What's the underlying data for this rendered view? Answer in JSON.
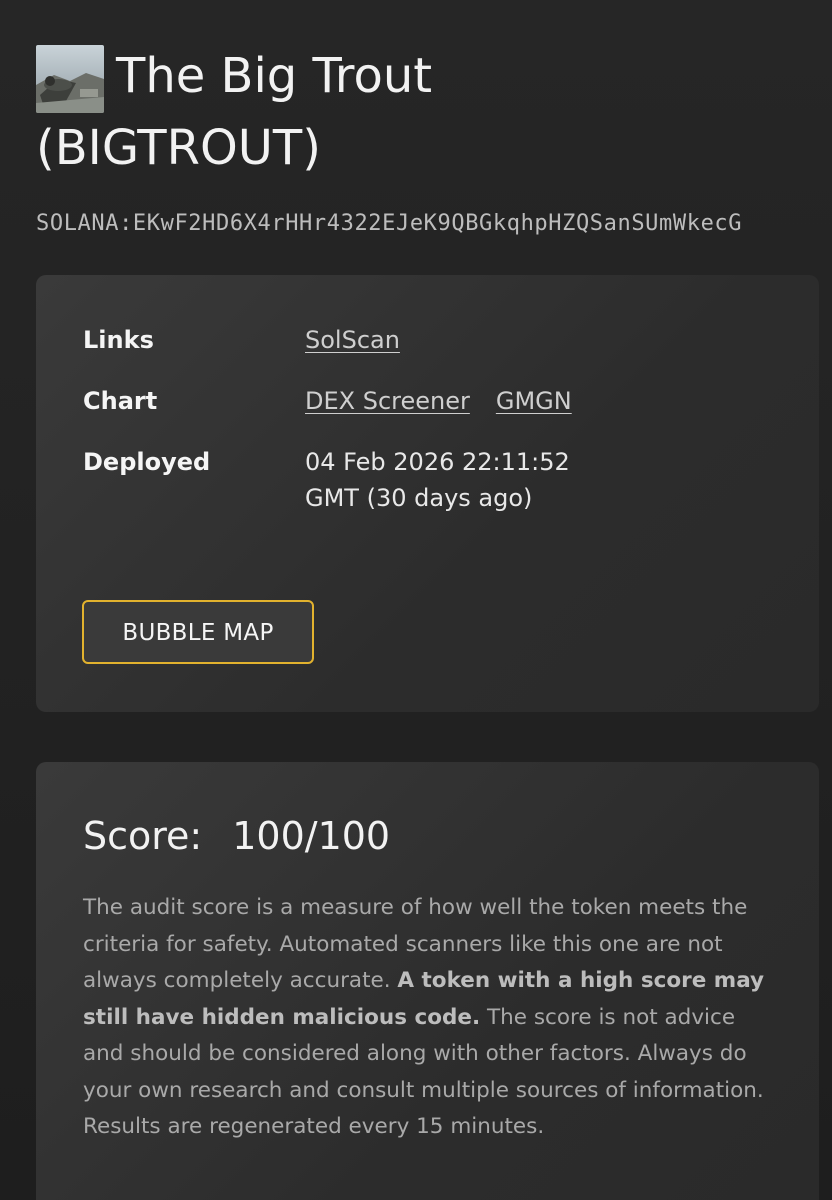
{
  "header": {
    "title_line1": "The Big Trout",
    "title_line2": "(BIGTROUT)",
    "address": "SOLANA:EKwF2HD6X4rHHr4322EJeK9QBGkqhpHZQSanSUmWkecG",
    "avatar_icon": "token-avatar-icon"
  },
  "info": {
    "links_label": "Links",
    "links": [
      "SolScan"
    ],
    "chart_label": "Chart",
    "chart_links": [
      "DEX Screener",
      "GMGN"
    ],
    "deployed_label": "Deployed",
    "deployed_value": "04 Feb 2026 22:11:52 GMT (30 days ago)",
    "bubble_map_label": "BUBBLE MAP"
  },
  "score": {
    "label": "Score:",
    "value": "100/100",
    "description_part1": "The audit score is a measure of how well the token meets the criteria for safety. Automated scanners like this one are not always completely accurate. ",
    "description_bold": "A token with a high score may still have hidden malicious code.",
    "description_part2": " The score is not advice and should be considered along with other factors. Always do your own research and consult multiple sources of information. Results are regenerated every 15 minutes."
  },
  "colors": {
    "accent": "#e2b22e",
    "background": "#1f1f1f",
    "card": "#333333"
  }
}
